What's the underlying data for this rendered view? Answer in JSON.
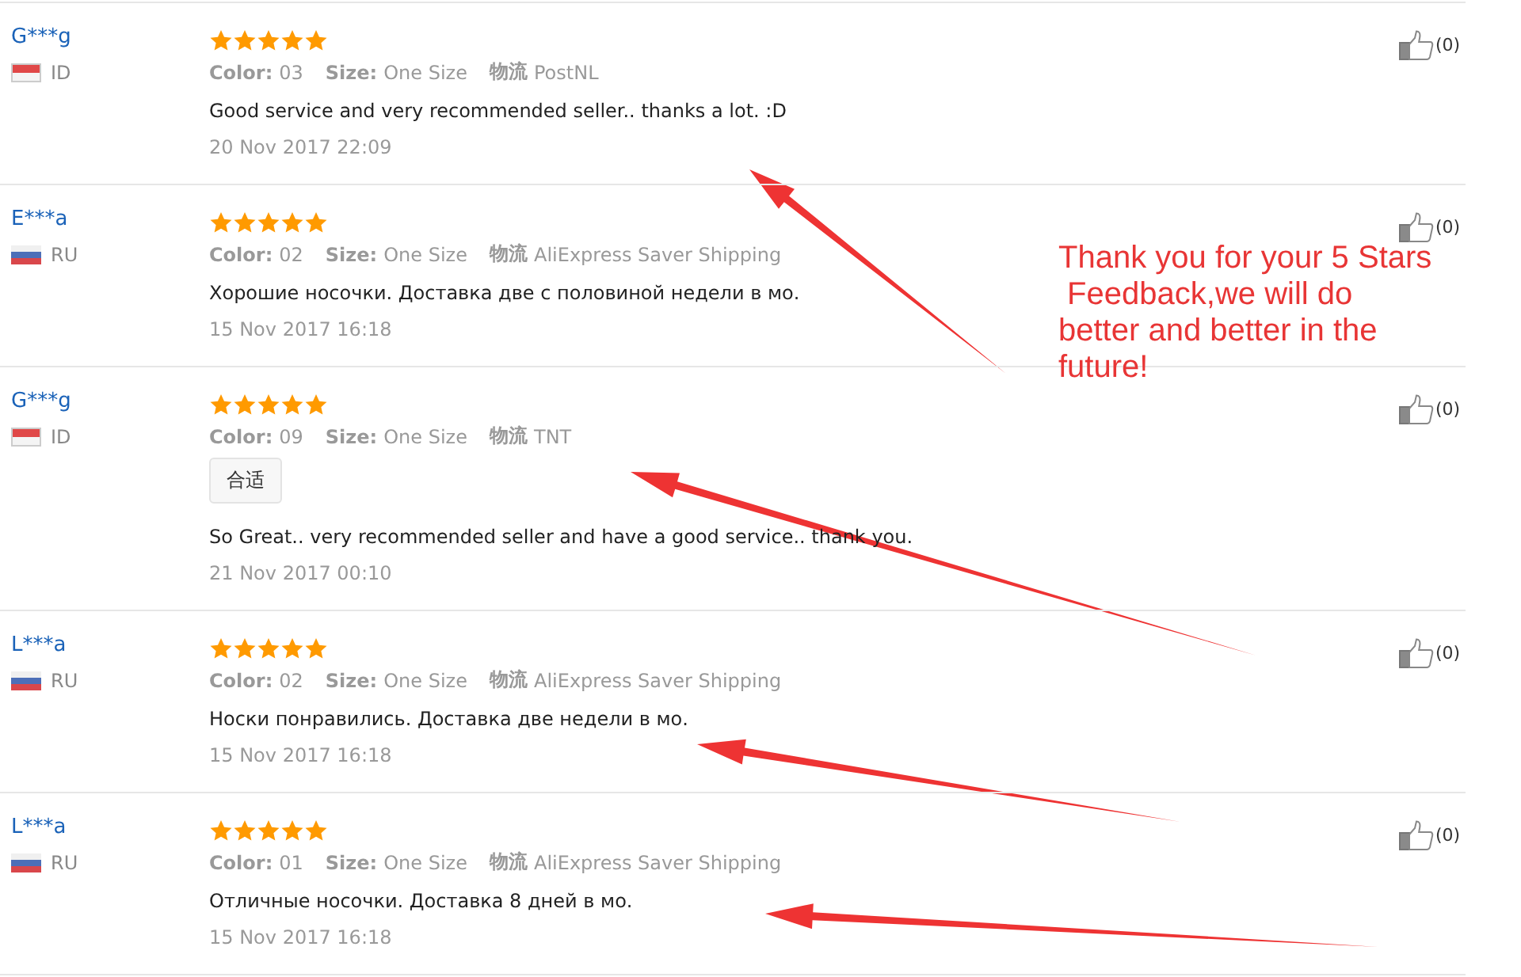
{
  "reviews": [
    {
      "name": "G***g",
      "flag": {
        "kind": "id"
      },
      "country": "ID",
      "stars": 5,
      "color_label": "Color:",
      "color_value": "03",
      "size_label": "Size:",
      "size": "One Size",
      "shipping_label": "物流",
      "shipping": "PostNL",
      "text": "Good service and very recommended seller.. thanks a lot. :D",
      "date": "20 Nov 2017 22:09",
      "likes": "(0)"
    },
    {
      "name": "E***a",
      "flag": {
        "kind": "ru"
      },
      "country": "RU",
      "stars": 5,
      "color_label": "Color:",
      "color_value": "02",
      "size_label": "Size:",
      "size": "One Size",
      "shipping_label": "物流",
      "shipping": "AliExpress Saver Shipping",
      "text": "Хорошие носочки. Доставка две с половиной недели в мо.",
      "date": "15 Nov 2017 16:18",
      "likes": "(0)"
    },
    {
      "name": "G***g",
      "flag": {
        "kind": "id"
      },
      "country": "ID",
      "stars": 5,
      "color_label": "Color:",
      "color_value": "09",
      "size_label": "Size:",
      "size": "One Size",
      "shipping_label": "物流",
      "shipping": "TNT",
      "tags": [
        "合适"
      ],
      "text": "So Great.. very recommended seller and have a good service.. thank you.",
      "date": "21 Nov 2017 00:10",
      "likes": "(0)"
    },
    {
      "name": "L***a",
      "flag": {
        "kind": "ru"
      },
      "country": "RU",
      "stars": 5,
      "color_label": "Color:",
      "color_value": "02",
      "size_label": "Size:",
      "size": "One Size",
      "shipping_label": "物流",
      "shipping": "AliExpress Saver Shipping",
      "text": "Носки понравились. Доставка две недели в мо.",
      "date": "15 Nov 2017 16:18",
      "likes": "(0)"
    },
    {
      "name": "L***a",
      "flag": {
        "kind": "ru"
      },
      "country": "RU",
      "stars": 5,
      "color_label": "Color:",
      "color_value": "01",
      "size_label": "Size:",
      "size": "One Size",
      "shipping_label": "物流",
      "shipping": "AliExpress Saver Shipping",
      "text": "Отличные носочки. Доставка 8 дней в мо.",
      "date": "15 Nov 2017 16:18",
      "likes": "(0)"
    }
  ],
  "annotation": {
    "text": "Thank you for your 5 Stars\n Feedback,we will do\nbetter and better in the\nfuture!"
  }
}
